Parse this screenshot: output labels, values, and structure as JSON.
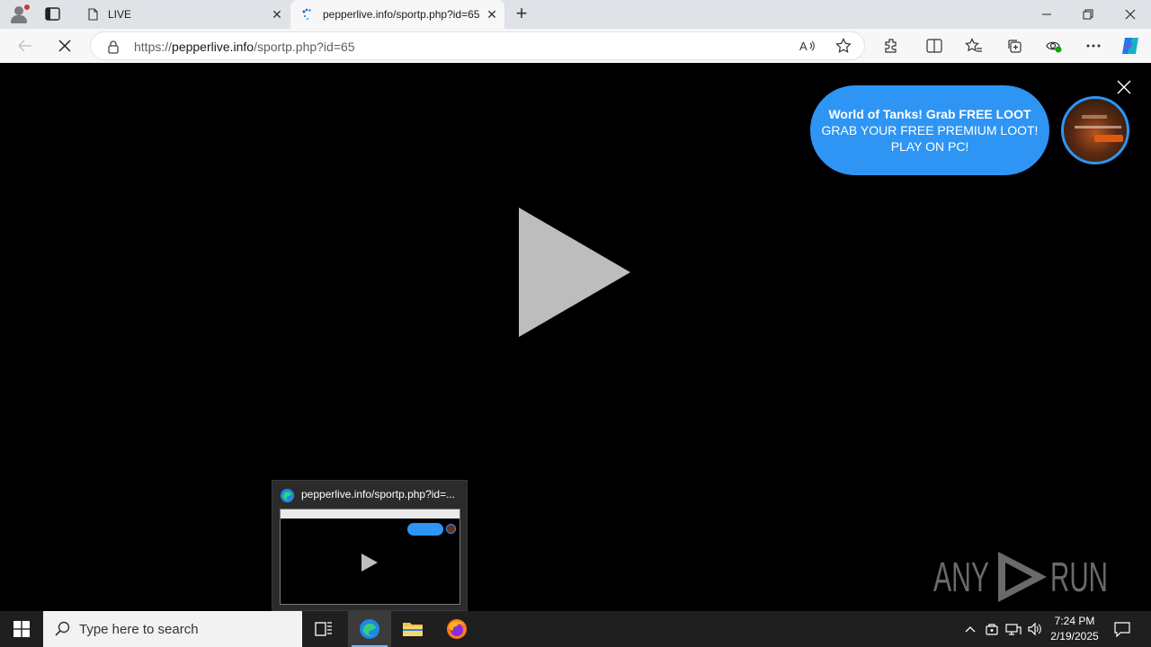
{
  "browser": {
    "tabs": [
      {
        "title": "LIVE",
        "active": false
      },
      {
        "title": "pepperlive.info/sportp.php?id=65",
        "active": true
      }
    ],
    "address": {
      "scheme": "https://",
      "domain": "pepperlive.info",
      "path": "/sportp.php?id=65"
    }
  },
  "ad": {
    "headline": "World of Tanks! Grab FREE LOOT",
    "body": "GRAB YOUR FREE PREMIUM LOOT! PLAY ON PC!"
  },
  "preview": {
    "title": "pepperlive.info/sportp.php?id=..."
  },
  "watermark": {
    "text": "ANY RUN"
  },
  "taskbar": {
    "search_placeholder": "Type here to search",
    "time": "7:24 PM",
    "date": "2/19/2025"
  },
  "colors": {
    "ad_bubble": "#2e95f4",
    "content_bg": "#000000",
    "tabstrip_bg": "#dfe3e7",
    "taskbar_bg": "#1f1f1f"
  }
}
